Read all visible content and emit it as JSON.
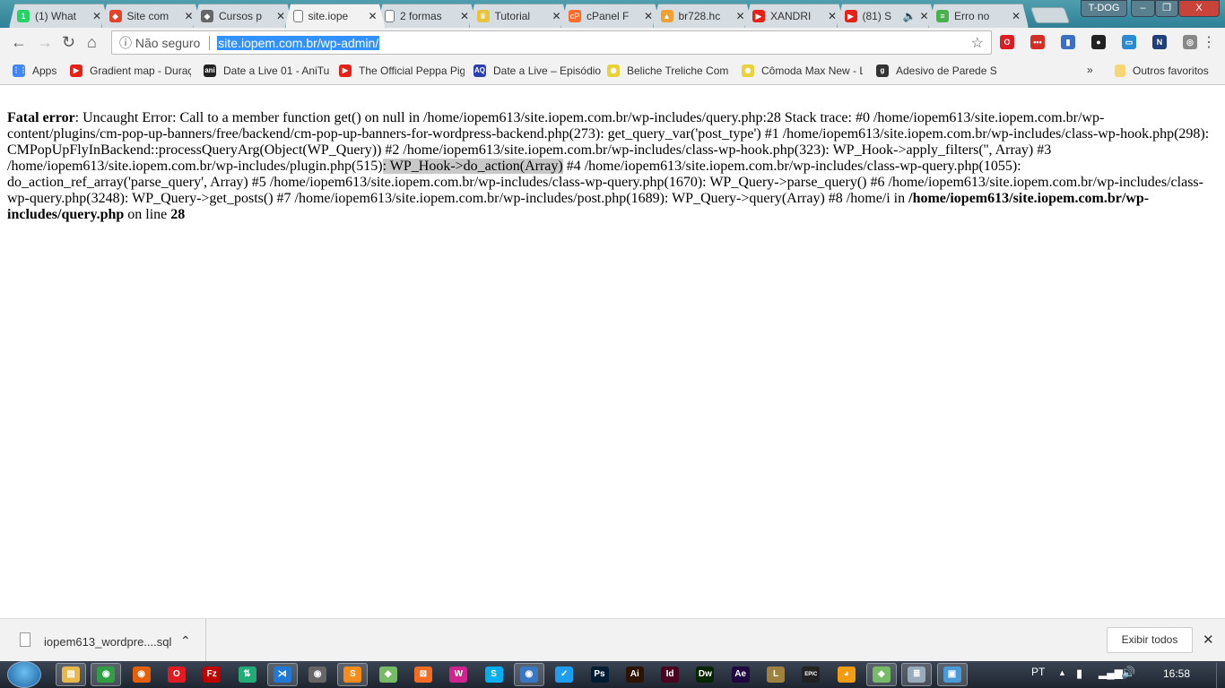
{
  "tabs": [
    {
      "label": "(1) What",
      "icon": "whatsapp-icon",
      "color": "#25d366",
      "glyph": "1"
    },
    {
      "label": "Site com",
      "icon": "gitlab-icon",
      "color": "#e2432a",
      "glyph": "◆"
    },
    {
      "label": "Cursos p",
      "icon": "shield-icon",
      "color": "#666",
      "glyph": "◆"
    },
    {
      "label": "site.iope",
      "icon": "page-icon",
      "color": "#fff",
      "glyph": "",
      "active": true
    },
    {
      "label": "2 formas",
      "icon": "page-icon",
      "color": "#fff",
      "glyph": ""
    },
    {
      "label": "Tutorial",
      "icon": "crown-icon",
      "color": "#e7c43b",
      "glyph": "♛"
    },
    {
      "label": "cPanel F",
      "icon": "cpanel-icon",
      "color": "#ff6c2c",
      "glyph": "cP"
    },
    {
      "label": "br728.hc",
      "icon": "phpmyadmin-icon",
      "color": "#f0a030",
      "glyph": "▲"
    },
    {
      "label": "XANDRI",
      "icon": "youtube-icon",
      "color": "#e62117",
      "glyph": "▶"
    },
    {
      "label": "(81) S",
      "icon": "youtube-icon",
      "color": "#e62117",
      "glyph": "▶",
      "audio": "🔈"
    },
    {
      "label": "Erro no",
      "icon": "stackoverflow-icon",
      "color": "#4caf50",
      "glyph": "≡"
    }
  ],
  "window": {
    "user": "T-DOG",
    "minimize": "–",
    "maximize": "❐",
    "close": "X"
  },
  "toolbar": {
    "security": "ⓘ Não seguro",
    "url": "site.iopem.com.br/wp-admin/"
  },
  "extensions": [
    {
      "icon": "opera-icon",
      "color": "#e01b22",
      "glyph": "O"
    },
    {
      "icon": "lastpass-icon",
      "color": "#d32d27",
      "glyph": "•••"
    },
    {
      "icon": "bookmark-icon",
      "color": "#3a6fc4",
      "glyph": "▮"
    },
    {
      "icon": "color-picker-icon",
      "color": "#222",
      "glyph": "●"
    },
    {
      "icon": "screencast-icon",
      "color": "#2a8ad4",
      "glyph": "▭"
    },
    {
      "icon": "news-icon",
      "color": "#1f3f7a",
      "glyph": "N"
    },
    {
      "icon": "extension-swirl-icon",
      "color": "#888",
      "glyph": "◎"
    }
  ],
  "bookmarks": [
    {
      "label": "Apps",
      "icon": "apps-grid-icon",
      "color": "#4285f4",
      "glyph": "⋮⋮"
    },
    {
      "label": "Gradient map - Duraç",
      "icon": "youtube-icon",
      "color": "#e62117",
      "glyph": "▶"
    },
    {
      "label": "Date a Live 01 - AniTu",
      "icon": "anitube-icon",
      "color": "#222",
      "glyph": "ani"
    },
    {
      "label": "The Official Peppa Pig",
      "icon": "youtube-icon",
      "color": "#e62117",
      "glyph": "▶"
    },
    {
      "label": "Date a Live – Episódio",
      "icon": "aq-icon",
      "color": "#2b3fb0",
      "glyph": "AQ"
    },
    {
      "label": "Beliche Treliche Com",
      "icon": "mercadolivre-icon",
      "color": "#e9d13a",
      "glyph": "◉"
    },
    {
      "label": "Cômoda Max New - L",
      "icon": "mercadolivre-icon",
      "color": "#e9d13a",
      "glyph": "◉"
    },
    {
      "label": "Adesivo de Parede Su",
      "icon": "g-icon",
      "color": "#333",
      "glyph": "g"
    }
  ],
  "bookmarks_more": "»",
  "other_bookmarks": "Outros favoritos",
  "error": {
    "title": "Fatal error",
    "part1": ": Uncaught Error: Call to a member function get() on null in /home/iopem613/site.iopem.com.br/wp-includes/query.php:28 Stack trace: #0 /home/iopem613/site.iopem.com.br/wp-content/plugins/cm-pop-up-banners/free/backend/cm-pop-up-banners-for-wordpress-backend.php(273): get_query_var('post_type') #1 /home/iopem613/site.iopem.com.br/wp-includes/class-wp-hook.php(298): CMPopUpFlyInBackend::processQueryArg(Object(WP_Query)) #2 /home/iopem613/site.iopem.com.br/wp-includes/class-wp-hook.php(323): WP_Hook->apply_filters('', Array) #3 /home/iopem613/site.iopem.com.br/wp-includes/plugin.php(515)",
    "highlighted": ": WP_Hook->do_action(Array)",
    "part2": " #4 /home/iopem613/site.iopem.com.br/wp-includes/class-wp-query.php(1055): do_action_ref_array('parse_query', Array) #5 /home/iopem613/site.iopem.com.br/wp-includes/class-wp-query.php(1670): WP_Query->parse_query() #6 /home/iopem613/site.iopem.com.br/wp-includes/class-wp-query.php(3248): WP_Query->get_posts() #7 /home/iopem613/site.iopem.com.br/wp-includes/post.php(1689): WP_Query->query(Array) #8 /home/i in ",
    "file": "/home/iopem613/site.iopem.com.br/wp-includes/query.php",
    "on_line": " on line ",
    "line": "28"
  },
  "download": {
    "filename": "iopem613_wordpre....sql",
    "show_all": "Exibir todos",
    "close": "✕",
    "chevron": "⌃"
  },
  "taskbar": {
    "apps": [
      {
        "icon": "explorer-icon",
        "color": "#e8b84a",
        "glyph": "▤",
        "open": true
      },
      {
        "icon": "chrome-icon",
        "color": "#2f9e44",
        "glyph": "◉",
        "open": true
      },
      {
        "icon": "firefox-icon",
        "color": "#e66000",
        "glyph": "◉"
      },
      {
        "icon": "opera-icon",
        "color": "#e01b22",
        "glyph": "O"
      },
      {
        "icon": "filezilla-icon",
        "color": "#bf0000",
        "glyph": "Fz"
      },
      {
        "icon": "network-icon",
        "color": "#2a7",
        "glyph": "⇅"
      },
      {
        "icon": "vscode-icon",
        "color": "#1e7ad6",
        "glyph": "⋊",
        "open": true
      },
      {
        "icon": "eye-app-icon",
        "color": "#666",
        "glyph": "◉"
      },
      {
        "icon": "sublime-icon",
        "color": "#f58c1a",
        "glyph": "S",
        "open": true
      },
      {
        "icon": "git-icon",
        "color": "#7b6",
        "glyph": "◆"
      },
      {
        "icon": "xampp-icon",
        "color": "#f36c21",
        "glyph": "⊠"
      },
      {
        "icon": "wamp-icon",
        "color": "#d0238d",
        "glyph": "W"
      },
      {
        "icon": "skype-icon",
        "color": "#00aff0",
        "glyph": "S"
      },
      {
        "icon": "thunderbird-icon",
        "color": "#3a78c3",
        "glyph": "◉",
        "open": true
      },
      {
        "icon": "todo-icon",
        "color": "#1e9ef0",
        "glyph": "✓"
      },
      {
        "icon": "photoshop-icon",
        "color": "#001d34",
        "glyph": "Ps"
      },
      {
        "icon": "illustrator-icon",
        "color": "#2e1300",
        "glyph": "Ai"
      },
      {
        "icon": "indesign-icon",
        "color": "#49021f",
        "glyph": "Id"
      },
      {
        "icon": "dreamweaver-icon",
        "color": "#072401",
        "glyph": "Dw"
      },
      {
        "icon": "aftereffects-icon",
        "color": "#1f0740",
        "glyph": "Ae"
      },
      {
        "icon": "league-icon",
        "color": "#a08040",
        "glyph": "L"
      },
      {
        "icon": "epic-games-icon",
        "color": "#222",
        "glyph": "EPIC"
      },
      {
        "icon": "duck-app-icon",
        "color": "#f39c12",
        "glyph": "◕"
      },
      {
        "icon": "git-icon",
        "color": "#7b6",
        "glyph": "◆",
        "open": true
      },
      {
        "icon": "notepad-icon",
        "color": "#9ab",
        "glyph": "≣",
        "open": true
      },
      {
        "icon": "image-viewer-icon",
        "color": "#4a9ad8",
        "glyph": "▣",
        "open": true
      }
    ],
    "language": "PT",
    "clock": "16:58"
  }
}
